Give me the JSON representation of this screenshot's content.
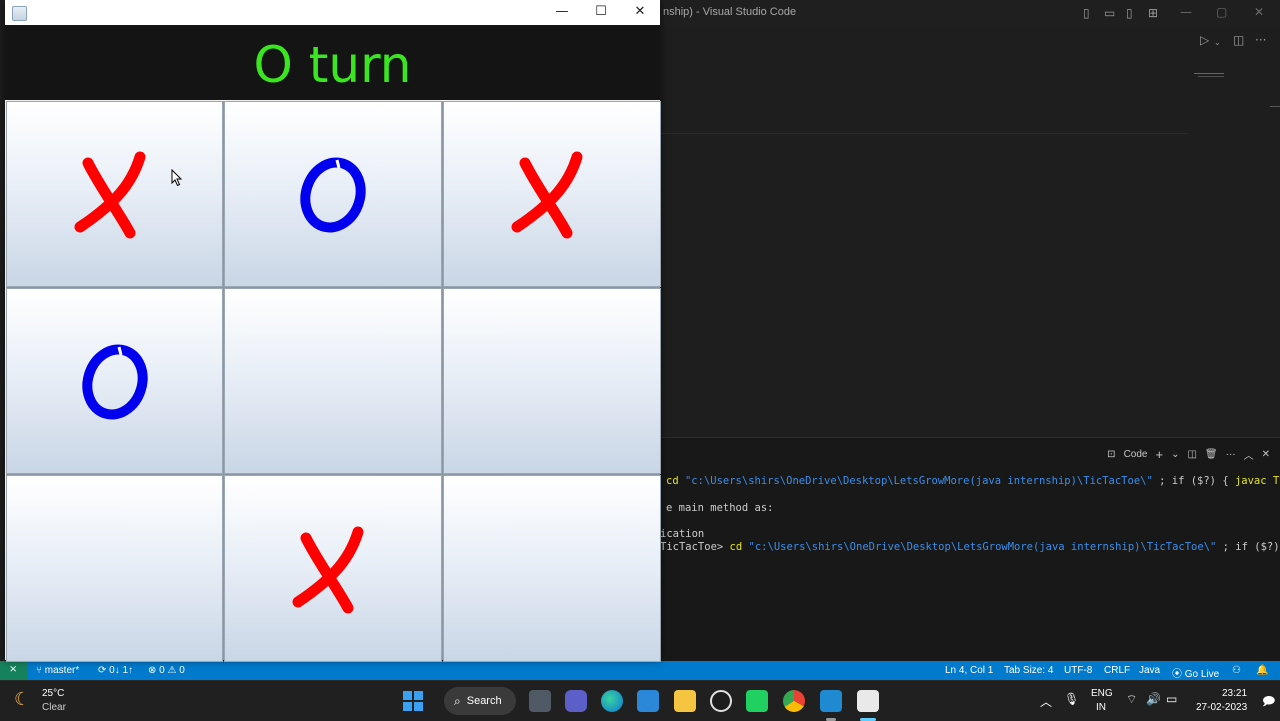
{
  "vscode": {
    "title": "nship) - Visual Studio Code",
    "terminal": {
      "profile_label": "Code",
      "lines": [
        {
          "prefix": "",
          "cmd": "cd",
          "path": "\"c:\\Users\\shirs\\OneDrive\\Desktop\\LetsGrowMore(java internship)\\TicTacToe\\\"",
          "rest": " ; if ($?) { ",
          "tail": "javac Tic"
        },
        {
          "text": "e main method as:"
        },
        {
          "text": "ication"
        },
        {
          "prompt": "TicTacToe> ",
          "cmd": "cd",
          "path": "\"c:\\Users\\shirs\\OneDrive\\Desktop\\LetsGrowMore(java internship)\\TicTacToe\\\"",
          "rest": " ; if ($?) {"
        }
      ]
    },
    "statusbar": {
      "branch": "master*",
      "sync": "0↓ 1↑",
      "problems": "⊗ 0 ⚠ 0",
      "position": "Ln 4, Col 1",
      "tab_size": "Tab Size: 4",
      "encoding": "UTF-8",
      "eol": "CRLF",
      "language": "Java",
      "go_live": "Go Live"
    }
  },
  "game": {
    "turn_text": "O turn",
    "board": [
      [
        "X",
        "O",
        "X"
      ],
      [
        "O",
        "",
        ""
      ],
      [
        "",
        "X",
        ""
      ]
    ],
    "colors": {
      "x": "#ff0000",
      "o": "#0000ee",
      "turn": "#39e61f"
    }
  },
  "taskbar": {
    "weather_temp": "25°C",
    "weather_desc": "Clear",
    "search_label": "Search",
    "lang_top": "ENG",
    "lang_bottom": "IN",
    "time": "23:21",
    "date": "27-02-2023"
  }
}
